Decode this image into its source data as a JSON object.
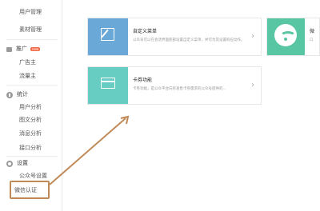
{
  "sidebar": {
    "top_items": [
      "用户管理",
      "素材管理"
    ],
    "promote": {
      "label": "推广",
      "badge": "new",
      "items": [
        "广告主",
        "流量主"
      ]
    },
    "stats": {
      "label": "统计",
      "items": [
        "用户分析",
        "图文分析",
        "消息分析",
        "接口分析"
      ]
    },
    "settings": {
      "label": "设置",
      "items": [
        "公众号设置",
        "微信认证"
      ]
    }
  },
  "cards": [
    {
      "title": "自定义菜单",
      "desc": "公众号可以在会话界面底部设置自定义菜单，并可为其设置响应动作。",
      "chevron": "›"
    },
    {
      "title": "卡券功能",
      "desc": "卡券功能，是公众平台向有发售卡券需求的公众号提供的...",
      "chevron": "›"
    }
  ],
  "right_card": {
    "title": "微",
    "desc": "口"
  },
  "colors": {
    "card_blue": "#6aa8d8",
    "card_teal": "#67cdc2",
    "card_green": "#59c6a3",
    "annotation": "#c08a58"
  },
  "icons": [
    "speaker-icon",
    "chart-icon",
    "gear-icon",
    "pencil-icon",
    "card-icon",
    "wifi-icon",
    "arrow-annotation"
  ]
}
